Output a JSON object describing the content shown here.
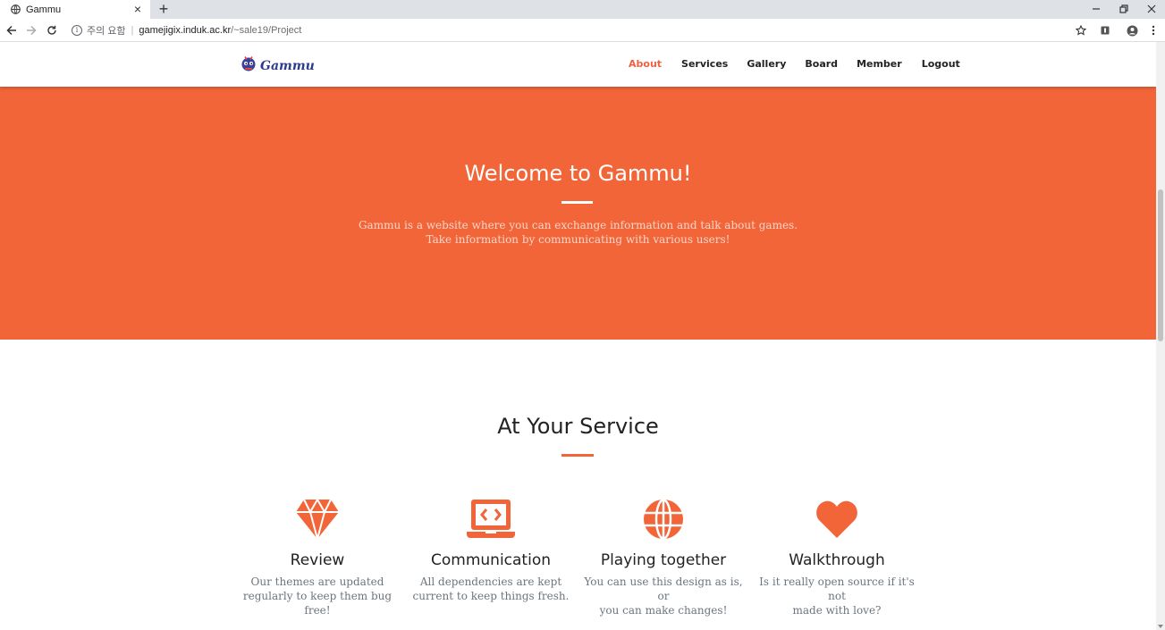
{
  "browser": {
    "tab_title": "Gammu",
    "security_label": "주의 요함",
    "url_host": "gamejigix.induk.ac.kr",
    "url_path": "/~sale19/Project"
  },
  "nav": {
    "brand": "Gammu",
    "items": [
      {
        "label": "About",
        "active": true
      },
      {
        "label": "Services",
        "active": false
      },
      {
        "label": "Gallery",
        "active": false
      },
      {
        "label": "Board",
        "active": false
      },
      {
        "label": "Member",
        "active": false
      },
      {
        "label": "Logout",
        "active": false
      }
    ]
  },
  "hero": {
    "title": "Welcome to Gammu!",
    "lines": [
      "Gammu is a website where you can exchange information and talk about games.",
      "Take information by communicating with various users!"
    ]
  },
  "services": {
    "title": "At Your Service",
    "items": [
      {
        "icon": "diamond-icon",
        "name": "Review",
        "desc": [
          "Our themes are updated",
          "regularly to keep them bug free!"
        ]
      },
      {
        "icon": "laptop-code-icon",
        "name": "Communication",
        "desc": [
          "All dependencies are kept",
          "current to keep things fresh."
        ]
      },
      {
        "icon": "globe-icon",
        "name": "Playing together",
        "desc": [
          "You can use this design as is, or",
          "you can make changes!"
        ]
      },
      {
        "icon": "heart-icon",
        "name": "Walkthrough",
        "desc": [
          "Is it really open source if it's not",
          "made with love?"
        ]
      }
    ]
  },
  "colors": {
    "accent": "#f26538",
    "active_link": "#f05f40"
  }
}
